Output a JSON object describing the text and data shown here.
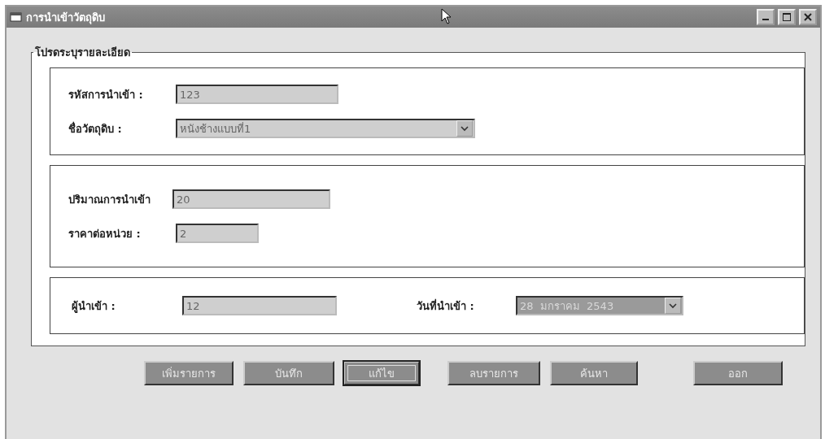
{
  "window": {
    "title": "การนำเข้าวัตถุดิบ"
  },
  "group_title": "โปรดระบุรายละเอียด",
  "sections": [
    {
      "fields": [
        {
          "label": "รหัสการนำเข้า :",
          "value": "123",
          "kind": "text"
        },
        {
          "label": "ชื่อวัตถุดิบ :",
          "value": "หนังช้างแบบที่1",
          "kind": "combo"
        }
      ]
    },
    {
      "fields": [
        {
          "label": "ปริมาณการนำเข้า",
          "value": "20",
          "kind": "text"
        },
        {
          "label": "ราคาต่อหน่วย :",
          "value": "2",
          "kind": "text"
        }
      ]
    },
    {
      "fields": [
        {
          "label": "ผู้นำเข้า :",
          "value": "12",
          "kind": "text"
        },
        {
          "label": "วันที่นำเข้า :",
          "value": "28  มกราคม  2543",
          "kind": "date"
        }
      ]
    }
  ],
  "buttons": [
    {
      "label": "เพิ่มรายการ",
      "focused": false
    },
    {
      "label": "บันทึก",
      "focused": false
    },
    {
      "label": "แก้ไข",
      "focused": true
    },
    {
      "label": "ลบรายการ",
      "focused": false
    },
    {
      "label": "ค้นหา",
      "focused": false
    },
    {
      "label": "ออก",
      "focused": false
    }
  ]
}
